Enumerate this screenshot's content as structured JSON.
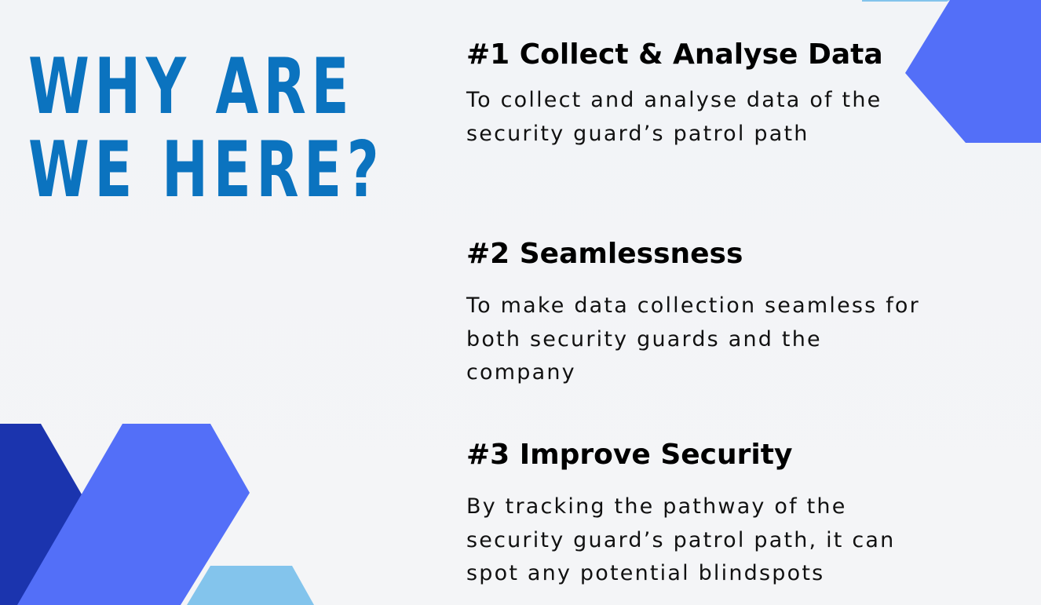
{
  "slide": {
    "title": {
      "line1": "WHY ARE",
      "line2": "WE HERE?"
    },
    "sections": [
      {
        "heading": "#1 Collect & Analyse Data",
        "body_lines": [
          "To collect and analyse data of the",
          "security guard’s patrol path"
        ]
      },
      {
        "heading": "#2 Seamlessness",
        "body_lines": [
          "To make data collection seamless for",
          "both security guards and the",
          "company"
        ]
      },
      {
        "heading": "#3  Improve Security",
        "body_lines": [
          "By tracking the pathway of the",
          "security guard’s patrol path, it can",
          "spot any potential blindspots"
        ]
      }
    ],
    "colors": {
      "title_blue": "#0b73bf",
      "accent_royal": "#536ff8",
      "accent_navy": "#1b34ae",
      "accent_sky": "#83c4ec",
      "background": "#f3f4f6"
    }
  }
}
